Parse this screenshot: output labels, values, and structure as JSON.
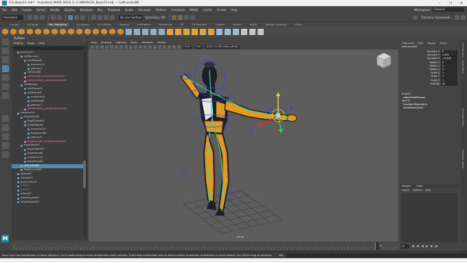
{
  "window": {
    "title": "CH_Base11.mb* - Autodesk MAYA 2024.1: C:\\MAYA\\CH_Base11.mb  ---  LeftcontrolIK",
    "buttons": [
      "–",
      "☐",
      "✕"
    ]
  },
  "menubar": {
    "items": [
      "File",
      "Edit",
      "Create",
      "Select",
      "Modify",
      "Display",
      "Windows",
      "Key",
      "Playback",
      "Audio",
      "Visualize",
      "Deform",
      "Constrain",
      "MASH",
      "Cache",
      "Arnold",
      "Help"
    ],
    "workspace_label": "Workspace:",
    "workspace_value": "General"
  },
  "statusline": {
    "mode": "Animation",
    "symmetry": "Symmetry: Off",
    "live_surface": "No Live Surface",
    "user": "Transoma Sossamadi..."
  },
  "shelf": {
    "tabs": [
      "Curves",
      "Surfaces",
      "Poly Modeling",
      "Sculpting",
      "UV Editing",
      "Rigging",
      "Animation",
      "Rendering",
      "FX",
      "FX Caching",
      "Custom",
      "Arnold",
      "MASH",
      "Motion Graphics",
      "XGen"
    ],
    "active_tab": "Poly Modeling"
  },
  "outliner": {
    "title": "Outliner",
    "menu": [
      "Display",
      "Show",
      "Help"
    ],
    "rows": [
      {
        "label": "transform7",
        "indent": 1,
        "style": ""
      },
      {
        "label": "LeftBicuarm",
        "indent": 2,
        "style": ""
      },
      {
        "label": "LeftElbowIK",
        "indent": 3,
        "style": ""
      },
      {
        "label": "transform5",
        "indent": 4,
        "style": ""
      },
      {
        "label": "effector4",
        "indent": 4,
        "style": ""
      },
      {
        "label": "LeftHandIK",
        "indent": 3,
        "style": ""
      },
      {
        "label": "LeftHandIK_parentConstraint1",
        "indent": 3,
        "style": "pink"
      },
      {
        "label": "LeftHandleIK_parentConstraint1",
        "indent": 3,
        "style": "pink"
      },
      {
        "label": "LeftWristIK",
        "indent": 2,
        "style": ""
      },
      {
        "label": "LeftElbowFK",
        "indent": 3,
        "style": ""
      },
      {
        "label": "LeftElbowIK",
        "indent": 3,
        "style": ""
      },
      {
        "label": "transform5",
        "indent": 4,
        "style": ""
      },
      {
        "label": "LeftHandIK",
        "indent": 4,
        "style": ""
      },
      {
        "label": "effector7",
        "indent": 4,
        "style": ""
      },
      {
        "label": "LeftHandleIK_parentConstraint1",
        "indent": 3,
        "style": "pink"
      },
      {
        "label": "transform9",
        "indent": 1,
        "style": ""
      },
      {
        "label": "RightWristIK",
        "indent": 2,
        "style": ""
      },
      {
        "label": "RightElbowFK",
        "indent": 3,
        "style": ""
      },
      {
        "label": "RightElbowIK",
        "indent": 3,
        "style": ""
      },
      {
        "label": "transform10",
        "indent": 4,
        "style": ""
      },
      {
        "label": "RightHandIK",
        "indent": 4,
        "style": ""
      },
      {
        "label": "effector5",
        "indent": 4,
        "style": ""
      },
      {
        "label": "RightHandIK_parentConstraint1",
        "indent": 3,
        "style": "pink"
      },
      {
        "label": "RightWristFK",
        "indent": 2,
        "style": ""
      },
      {
        "label": "RightElbowFK",
        "indent": 3,
        "style": ""
      },
      {
        "label": "RightHandIK",
        "indent": 3,
        "style": ""
      },
      {
        "label": "transform14",
        "indent": 3,
        "style": ""
      },
      {
        "label": "RightHandIK",
        "indent": 3,
        "style": ""
      },
      {
        "label": "LeftcontrolIK",
        "indent": 2,
        "style": "sel"
      },
      {
        "label": "RightcontrolIK",
        "indent": 2,
        "style": ""
      },
      {
        "label": "AlllendsT",
        "indent": 1,
        "style": ""
      },
      {
        "label": "AllendsS3",
        "indent": 1,
        "style": ""
      },
      {
        "label": "polySurface1",
        "indent": 1,
        "style": ""
      },
      {
        "label": "pelvis1",
        "indent": 1,
        "style": "dim"
      },
      {
        "label": "pelvis2",
        "indent": 1,
        "style": "dim"
      },
      {
        "label": "AlllendsT",
        "indent": 1,
        "style": ""
      },
      {
        "label": "AllfolkRightDef",
        "indent": 1,
        "style": ""
      },
      {
        "label": "AllfolkRightDef",
        "indent": 1,
        "style": ""
      }
    ]
  },
  "viewport": {
    "menu": [
      "View",
      "Shading",
      "Lighting",
      "Show",
      "Renderer",
      "Panels"
    ],
    "field_a": "0.00",
    "field_b": "1.00",
    "colorspace": "ACES 1.0 SDR-video (sRGB)",
    "camera": "persp"
  },
  "channelbox": {
    "menu": [
      "Channels",
      "Edit",
      "Object",
      "Show"
    ],
    "object": "LeftcontrolIK",
    "attributes": [
      {
        "name": "Translate X",
        "value": "0"
      },
      {
        "name": "Translate Y",
        "value": "5.054"
      },
      {
        "name": "Translate Z",
        "value": "-13.893"
      },
      {
        "name": "Rotate X",
        "value": "0"
      },
      {
        "name": "Rotate Y",
        "value": "0"
      },
      {
        "name": "Rotate Z",
        "value": "0"
      },
      {
        "name": "Scale X",
        "value": "1"
      },
      {
        "name": "Scale Y",
        "value": "1"
      },
      {
        "name": "Scale Z",
        "value": "1"
      },
      {
        "name": "Visibility",
        "value": "on"
      }
    ],
    "shapes_label": "SHAPES",
    "shape_item": "LeftcontrolIKShape",
    "inputs_label": "INPUTS",
    "input_items": [
      "transformGeometry1",
      "makeNurbCircle1"
    ],
    "layer_tabs": [
      "Display",
      "Anim"
    ],
    "layer_menu": [
      "Layers",
      "Options",
      "Help"
    ]
  },
  "right_tabs": [
    "Channel Box / Layer Editor",
    "Attribute Editor",
    "Modeling Toolkit"
  ],
  "timeslider": {
    "current_frame": "22",
    "start": "1",
    "end": "120"
  },
  "playback": {
    "frame": "22"
  },
  "helpline": {
    "text": "Move Tool: Use manipulator to move object(s). Ctrl+middle-drag to move components along normals. Shift+drag manipulator axis or plane handles to extrude components or clone objects. Ctrl+Shift+drag to constrain",
    "mel_label": "MEL"
  },
  "colors": {
    "selection": "#5285a6",
    "maya_teal": "#1a8b96",
    "character_orange": "#e59a1c",
    "character_dark": "#1c1e28"
  }
}
